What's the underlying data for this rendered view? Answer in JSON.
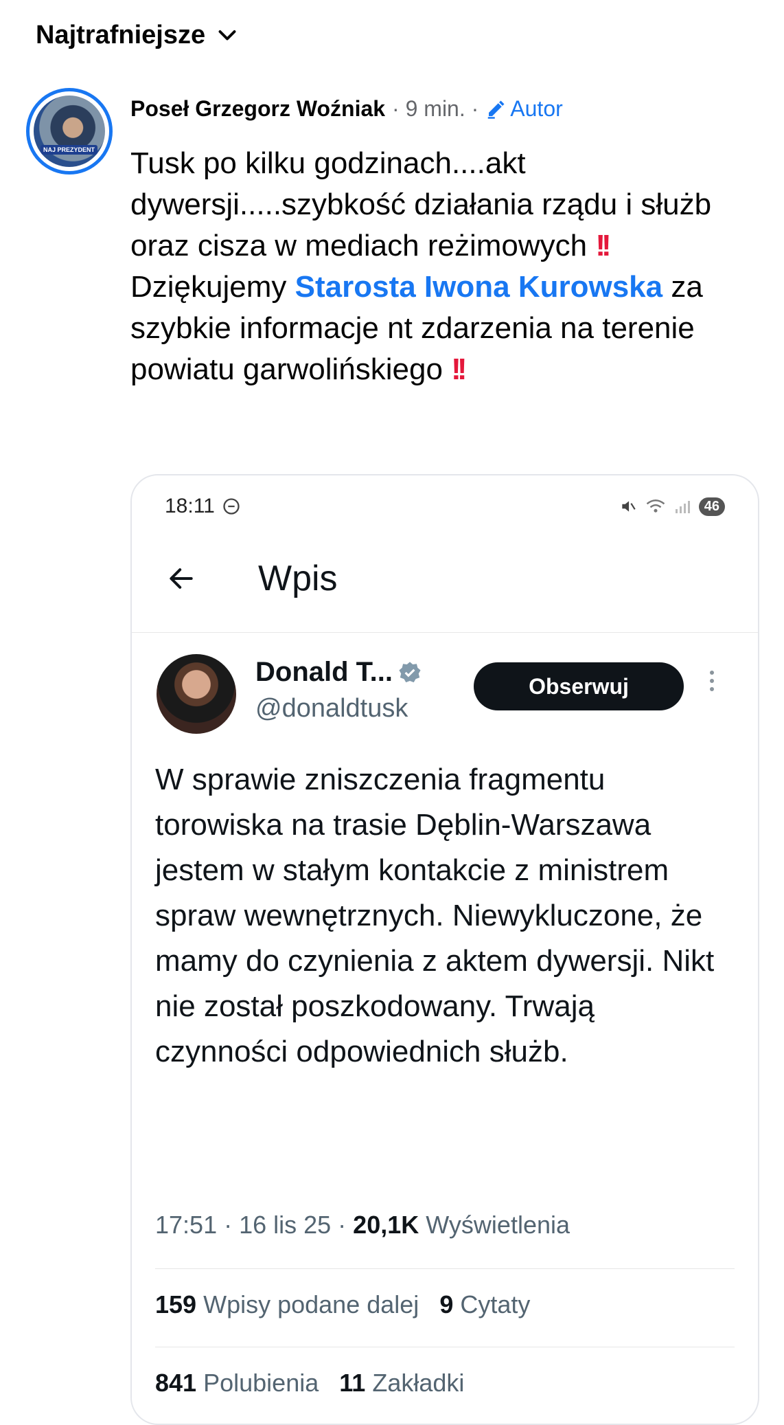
{
  "sort": {
    "label": "Najtrafniejsze"
  },
  "comment": {
    "author": "Poseł Grzegorz Woźniak",
    "time": "· 9 min. ·",
    "author_badge": "Autor",
    "avatar_badge": "NAJ PREZYDENT",
    "text_line1": "Tusk po kilku godzinach....akt dywersji.....szybkość działania rządu i służb oraz cisza w mediach reżimowych",
    "text_line2_prefix": "Dziękujemy",
    "mention": "Starosta Iwona Kurowska",
    "text_line2_suffix": "za szybkie informacje nt zdarzenia na terenie powiatu garwolińskiego",
    "emoji": "!!"
  },
  "screenshot": {
    "status_time": "18:11",
    "battery": "46",
    "header_title": "Wpis",
    "tweet": {
      "name": "Donald T...",
      "handle": "@donaldtusk",
      "follow_label": "Obserwuj",
      "text": "W sprawie zniszczenia fragmentu torowiska na trasie Dęblin-Warszawa jestem w stałym kontakcie z ministrem spraw wewnętrznych. Niewykluczone, że mamy do czynienia z aktem dywersji. Nikt nie został poszkodowany. Trwają czynności odpowiednich służb.",
      "time": "17:51 · 16 lis 25 ·",
      "views": "20,1K",
      "views_label": "Wyświetlenia",
      "reposts": "159",
      "reposts_label": "Wpisy podane dalej",
      "quotes": "9",
      "quotes_label": "Cytaty",
      "likes": "841",
      "likes_label": "Polubienia",
      "bookmarks": "11",
      "bookmarks_label": "Zakładki"
    }
  }
}
